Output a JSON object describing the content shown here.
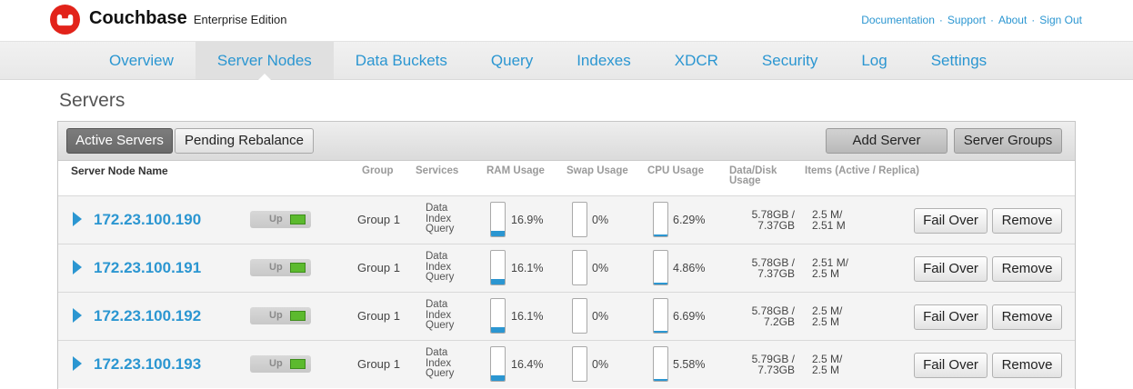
{
  "header": {
    "brand": "Couchbase",
    "edition": "Enterprise Edition",
    "links": [
      "Documentation",
      "Support",
      "About",
      "Sign Out"
    ],
    "separator": "·"
  },
  "nav": {
    "tabs": [
      {
        "label": "Overview",
        "active": false
      },
      {
        "label": "Server Nodes",
        "active": true
      },
      {
        "label": "Data Buckets",
        "active": false
      },
      {
        "label": "Query",
        "active": false
      },
      {
        "label": "Indexes",
        "active": false
      },
      {
        "label": "XDCR",
        "active": false
      },
      {
        "label": "Security",
        "active": false
      },
      {
        "label": "Log",
        "active": false
      },
      {
        "label": "Settings",
        "active": false
      }
    ]
  },
  "page": {
    "title": "Servers"
  },
  "toolbar": {
    "view_tabs": [
      {
        "label": "Active Servers",
        "active": true
      },
      {
        "label": "Pending Rebalance",
        "active": false
      }
    ],
    "add_server": "Add Server",
    "server_groups": "Server Groups"
  },
  "table": {
    "columns": {
      "name": "Server Node Name",
      "group": "Group",
      "services": "Services",
      "ram": "RAM Usage",
      "swap": "Swap Usage",
      "cpu": "CPU Usage",
      "data_disk": [
        "Data/Disk",
        "Usage"
      ],
      "items": "Items (Active / Replica)"
    },
    "actions": {
      "fail_over": "Fail Over",
      "remove": "Remove"
    },
    "rows": [
      {
        "name": "172.23.100.190",
        "status": "Up",
        "group": "Group 1",
        "services": [
          "Data",
          "Index",
          "Query"
        ],
        "ram": "16.9%",
        "swap": "0%",
        "cpu": "6.29%",
        "data_disk": [
          "5.78GB /",
          "7.37GB"
        ],
        "items": [
          "2.5 M/",
          "2.51 M"
        ]
      },
      {
        "name": "172.23.100.191",
        "status": "Up",
        "group": "Group 1",
        "services": [
          "Data",
          "Index",
          "Query"
        ],
        "ram": "16.1%",
        "swap": "0%",
        "cpu": "4.86%",
        "data_disk": [
          "5.78GB /",
          "7.37GB"
        ],
        "items": [
          "2.51 M/",
          "2.5 M"
        ]
      },
      {
        "name": "172.23.100.192",
        "status": "Up",
        "group": "Group 1",
        "services": [
          "Data",
          "Index",
          "Query"
        ],
        "ram": "16.1%",
        "swap": "0%",
        "cpu": "6.69%",
        "data_disk": [
          "5.78GB /",
          "7.2GB"
        ],
        "items": [
          "2.5 M/",
          "2.5 M"
        ]
      },
      {
        "name": "172.23.100.193",
        "status": "Up",
        "group": "Group 1",
        "services": [
          "Data",
          "Index",
          "Query"
        ],
        "ram": "16.4%",
        "swap": "0%",
        "cpu": "5.58%",
        "data_disk": [
          "5.79GB /",
          "7.73GB"
        ],
        "items": [
          "2.5 M/",
          "2.5 M"
        ]
      }
    ]
  },
  "icons": {
    "logo": "couchbase-logo-icon",
    "row_expand": "expand-triangle-icon",
    "status": "status-light-icon"
  },
  "colors": {
    "accent": "#2b96d1",
    "brand": "#e2231a",
    "status": "#5cba2e",
    "active-tab": "#6a6a6a"
  }
}
